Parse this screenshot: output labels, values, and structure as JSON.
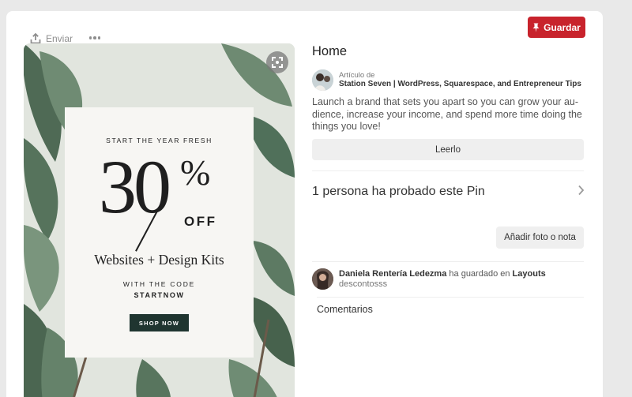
{
  "toolbar": {
    "send_label": "Enviar",
    "save_label": "Guardar",
    "save_color": "#c8232c"
  },
  "pin_image": {
    "promo": {
      "top_line": "START THE YEAR FRESH",
      "number": "30",
      "percent": "%",
      "off": "OFF",
      "subtitle": "Websites + Design Kits",
      "with_code": "WITH THE CODE",
      "code": "STARTNOW",
      "shop_button": "SHOP NOW",
      "button_color": "#1f3530"
    }
  },
  "details": {
    "title": "Home",
    "article_label": "Artículo de",
    "article_source": "Station Seven | WordPress, Squarespace, and Entrepreneur Tips",
    "description": "Launch a brand that sets you apart so you can grow your au-dience, increase your income, and spend more time doing the things you love!",
    "read_button": "Leerlo",
    "tried_text": "1 persona ha probado este Pin",
    "add_photo_button": "Añadir foto o nota"
  },
  "saved_by": {
    "user": "Daniela Rentería Ledezma",
    "action": "ha guardado en",
    "board": "Layouts",
    "description": "descontosss"
  },
  "comments": {
    "title": "Comentarios"
  }
}
